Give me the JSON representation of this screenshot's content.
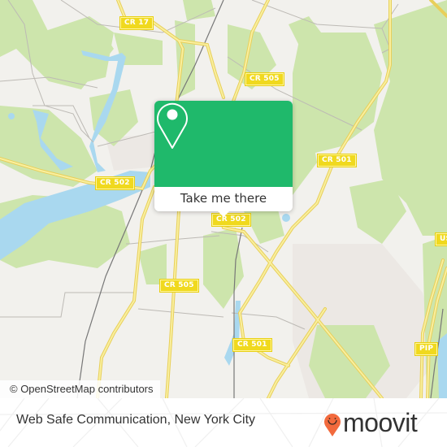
{
  "map": {
    "road_labels": [
      {
        "id": "cr17",
        "text": "CR 17"
      },
      {
        "id": "cr505-north",
        "text": "CR 505"
      },
      {
        "id": "cr501-north",
        "text": "CR 501"
      },
      {
        "id": "cr502-west",
        "text": "CR 502"
      },
      {
        "id": "cr502-center",
        "text": "CR 502"
      },
      {
        "id": "cr505-south",
        "text": "CR 505"
      },
      {
        "id": "cr501-south",
        "text": "CR 501"
      },
      {
        "id": "us-east",
        "text": "US"
      },
      {
        "id": "pip",
        "text": "PIP"
      }
    ],
    "attribution": "© OpenStreetMap contributors",
    "colors": {
      "land": "#f2f1ed",
      "forest": "#cde5ac",
      "water": "#a9d8ef",
      "urban": "#ece8e4",
      "road_major": "#f6e27a",
      "road_minor": "#bdbab5",
      "railway": "#777777"
    }
  },
  "popup": {
    "icon": "map-pin-icon",
    "action_label": "Take me there",
    "accent_color": "#1fb96b"
  },
  "footer": {
    "place_name": "Web Safe Communication, New York City",
    "brand": "moovit",
    "brand_color": "#f26a3d"
  }
}
